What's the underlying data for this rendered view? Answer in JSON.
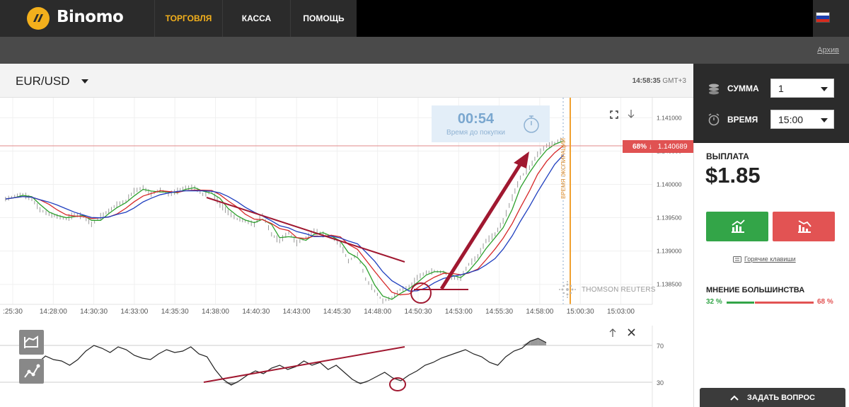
{
  "header": {
    "brand": "Binomo",
    "nav": [
      {
        "label": "ТОРГОВЛЯ",
        "active": true
      },
      {
        "label": "КАССА",
        "active": false
      },
      {
        "label": "ПОМОЩЬ",
        "active": false
      }
    ],
    "accent_color": "#f3b01c"
  },
  "subbar": {
    "archive_link": "Архив"
  },
  "chart_header": {
    "pair": "EUR/USD",
    "time": "14:58:35",
    "timezone": "GMT+3"
  },
  "timer": {
    "value": "00:54",
    "label": "Время до покупки"
  },
  "expiry_label": "ВРЕМЯ ЭКСПИРАЦИИ",
  "price_tag": {
    "percent": "68% ↓",
    "price": "1.140689"
  },
  "watermark": "THOMSON REUTERS",
  "chart_data": {
    "type": "line",
    "y_ticks": [
      "1.141000",
      "1.140500",
      "1.140000",
      "1.139500",
      "1.139000",
      "1.138500"
    ],
    "x_ticks": [
      ":25:30",
      "14:28:00",
      "14:30:30",
      "14:33:00",
      "14:35:30",
      "14:38:00",
      "14:40:30",
      "14:43:00",
      "14:45:30",
      "14:48:00",
      "14:50:30",
      "14:53:00",
      "14:55:30",
      "14:58:00",
      "15:00:30",
      "15:03:00"
    ],
    "ylim": [
      1.1382,
      1.1413
    ],
    "current_price": 1.140689,
    "series": [
      {
        "color": "#999999",
        "x": [
          14.423,
          14.432,
          14.44,
          14.449,
          14.457,
          14.466,
          14.474,
          14.483,
          14.491,
          14.5,
          14.508,
          14.517,
          14.525,
          14.533,
          14.542,
          14.55,
          14.559,
          14.567,
          14.576,
          14.584,
          14.593,
          14.601,
          14.61,
          14.618,
          14.627,
          14.635,
          14.643,
          14.652,
          14.66,
          14.669,
          14.677,
          14.686,
          14.694,
          14.703,
          14.711,
          14.72,
          14.728,
          14.737,
          14.745,
          14.754,
          14.762,
          14.771,
          14.779,
          14.788,
          14.796,
          14.805,
          14.813,
          14.822,
          14.83,
          14.839,
          14.847,
          14.856,
          14.864,
          14.873,
          14.881,
          14.89,
          14.898,
          14.907,
          14.915,
          14.924,
          14.932,
          14.941,
          14.949,
          14.958,
          14.966,
          14.975
        ],
        "y": [
          1.13978,
          1.13982,
          1.13985,
          1.13978,
          1.13962,
          1.13955,
          1.13952,
          1.13948,
          1.13955,
          1.13952,
          1.1394,
          1.13952,
          1.1396,
          1.1397,
          1.13975,
          1.1399,
          1.13995,
          1.13985,
          1.13992,
          1.13985,
          1.1399,
          1.13995,
          1.13995,
          1.13985,
          1.13988,
          1.1397,
          1.13958,
          1.13948,
          1.13945,
          1.1394,
          1.13955,
          1.13925,
          1.13915,
          1.13928,
          1.13912,
          1.1392,
          1.1393,
          1.13925,
          1.1392,
          1.1391,
          1.13885,
          1.13895,
          1.13858,
          1.1384,
          1.13825,
          1.1383,
          1.13842,
          1.13845,
          1.1386,
          1.13868,
          1.1387,
          1.13868,
          1.1386,
          1.1386,
          1.1388,
          1.13892,
          1.13915,
          1.13925,
          1.13945,
          1.1398,
          1.1401,
          1.14025,
          1.14045,
          1.14058,
          1.14062,
          1.14069
        ]
      }
    ],
    "moving_averages": [
      {
        "color": "#2ca02c"
      },
      {
        "color": "#d62728"
      },
      {
        "color": "#1f3fbf"
      }
    ]
  },
  "oscillator": {
    "levels": [
      "70",
      "30"
    ],
    "ylim": [
      0,
      100
    ],
    "values": [
      40,
      46,
      55,
      65,
      60,
      58,
      52,
      60,
      72,
      80,
      76,
      70,
      78,
      74,
      66,
      62,
      60,
      68,
      74,
      70,
      72,
      78,
      68,
      64,
      46,
      32,
      24,
      30,
      38,
      44,
      40,
      48,
      52,
      46,
      50,
      58,
      52,
      56,
      46,
      52,
      42,
      32,
      26,
      30,
      36,
      42,
      34,
      30,
      38,
      44,
      52,
      56,
      62,
      66,
      70,
      74,
      68,
      64,
      56,
      52,
      64,
      72,
      76,
      86,
      90,
      84
    ]
  },
  "panel": {
    "amount_label": "СУММА",
    "amount_value": "1",
    "time_label": "ВРЕМЯ",
    "time_value": "15:00",
    "payout_label": "ВЫПЛАТА",
    "payout_value": "$1.85",
    "hotkeys": "Горячие клавиши",
    "majority_label": "МНЕНИЕ БОЛЬШИНСТВА",
    "majority_up": "32 %",
    "majority_down": "68 %",
    "majority_up_value": 32,
    "up_color": "#33a548",
    "down_color": "#e25353"
  },
  "ask": {
    "label": "ЗАДАТЬ ВОПРОС"
  }
}
